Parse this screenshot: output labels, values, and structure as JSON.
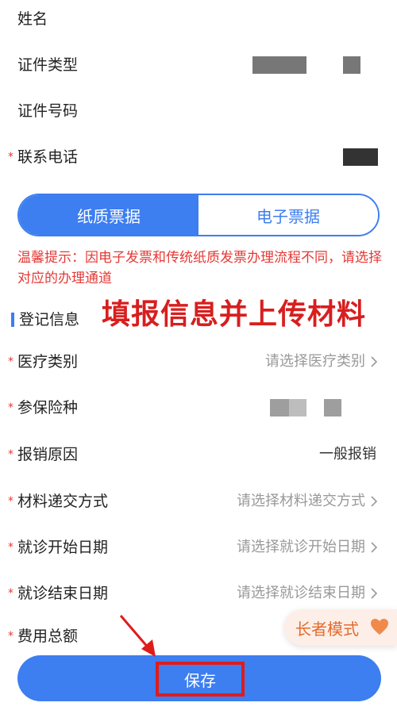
{
  "personal_info": {
    "name_label": "姓名",
    "id_type_label": "证件类型",
    "id_number_label": "证件号码",
    "phone_label": "联系电话",
    "required_mark": "*"
  },
  "invoice_type": {
    "paper": "纸质票据",
    "electronic": "电子票据",
    "selected": "纸质票据"
  },
  "tip": "温馨提示：因电子发票和传统纸质发票办理流程不同，请选择对应的办理通道",
  "section": {
    "title": "登记信息",
    "overlay_annotation": "填报信息并上传材料"
  },
  "form": {
    "medical_category": {
      "label": "医疗类别",
      "placeholder": "请选择医疗类别"
    },
    "insurance_type": {
      "label": "参保险种"
    },
    "reason": {
      "label": "报销原因",
      "value": "一般报销"
    },
    "submit_method": {
      "label": "材料递交方式",
      "placeholder": "请选择材料递交方式"
    },
    "start_date": {
      "label": "就诊开始日期",
      "placeholder": "请选择就诊开始日期"
    },
    "end_date": {
      "label": "就诊结束日期",
      "placeholder": "请选择就诊结束日期"
    },
    "total_fee": {
      "label": "费用总额"
    }
  },
  "elder_mode": "长者模式",
  "save_button": "保存",
  "colors": {
    "primary": "#3d7ef0",
    "required": "#e53935",
    "annotation_red": "#d81e1e",
    "elder_text": "#e36b2d"
  },
  "icons": {
    "chevron": "chevron-right-icon",
    "heart": "heart-icon",
    "arrow": "annotation-arrow-icon"
  }
}
